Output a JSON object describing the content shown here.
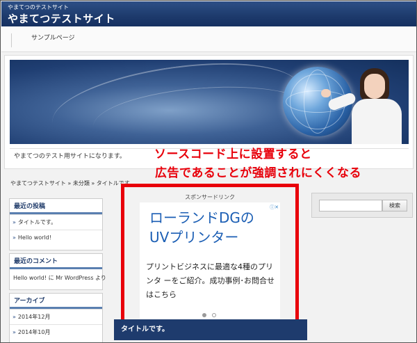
{
  "header": {
    "description": "やまてつのテストサイト",
    "title": "やまてつテストサイト",
    "bg_color": "#1d3a6c"
  },
  "nav": {
    "items": [
      {
        "label": "サンプルページ"
      }
    ]
  },
  "hero": {
    "caption": "やまてつのテスト用サイトになります。"
  },
  "annotation": {
    "line1": "ソースコード上に設置すると",
    "line2": "広告であることが強調されにくくなる",
    "color": "#e8000b"
  },
  "breadcrumb": {
    "text": "やまてつテストサイト » 未分類 » タイトルです。"
  },
  "sidebar": {
    "recent_posts": {
      "title": "最近の投稿",
      "items": [
        {
          "label": "タイトルです。"
        },
        {
          "label": "Hello world!"
        }
      ]
    },
    "recent_comments": {
      "title": "最近のコメント",
      "items": [
        {
          "label": "Hello world! に Mr WordPress より"
        }
      ]
    },
    "archives": {
      "title": "アーカイブ",
      "items": [
        {
          "label": "2014年12月"
        },
        {
          "label": "2014年10月"
        }
      ]
    }
  },
  "ad": {
    "label": "スポンサードリンク",
    "info_icon": "adchoices-icon",
    "headline_line1": "ローランドDGの",
    "headline_line2": "UVプリンター",
    "body": "プリントビジネスに最適な4種のプリンタ ーをご紹介。成功事例･お問合せはこちら",
    "slide_count": 2,
    "active_slide": 1
  },
  "post": {
    "title": "タイトルです。"
  },
  "search": {
    "placeholder": "",
    "button_label": "検索"
  }
}
